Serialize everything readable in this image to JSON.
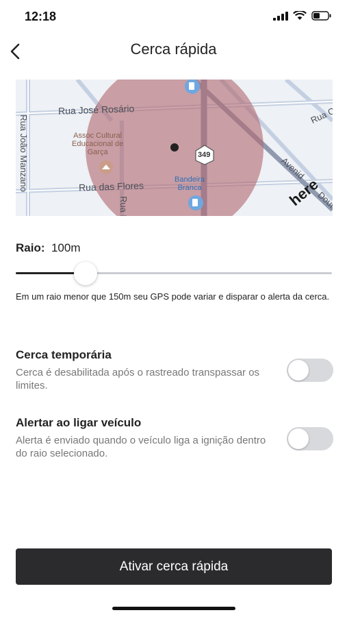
{
  "status_bar": {
    "time": "12:18"
  },
  "header": {
    "title": "Cerca rápida",
    "back_icon": "chevron-left-icon"
  },
  "map": {
    "streets": {
      "rua_jose_rosario": "Rua José Rosário",
      "rua_joao_manzano": "Rua João Manzano",
      "rua_das_flores": "Rua das Flores",
      "rua_vertical": "Rua I",
      "avenida": "Avenid",
      "avenida_suffix": "Dout",
      "rua_right": "Rua C"
    },
    "pois": {
      "assoc_cultural": "Assoc Cultural\nEducacional de\nGarça",
      "bandeira_branca": "Bandeira\nBranca"
    },
    "road_shield": "349",
    "logo": "here",
    "colors": {
      "circle": "#b26b72",
      "background": "#eef1f5"
    }
  },
  "radius": {
    "label": "Raio:",
    "value": "100m",
    "slider_fraction": 0.22
  },
  "hint": "Em um raio menor que 150m seu GPS pode variar e disparar o alerta da cerca.",
  "settings": [
    {
      "title": "Cerca temporária",
      "description": "Cerca é desabilitada após o rastreado transpassar os limites.",
      "enabled": false
    },
    {
      "title": "Alertar ao ligar veículo",
      "description": "Alerta é enviado quando o veículo liga a ignição dentro do raio selecionado.",
      "enabled": false
    }
  ],
  "cta": {
    "label": "Ativar cerca rápida"
  }
}
